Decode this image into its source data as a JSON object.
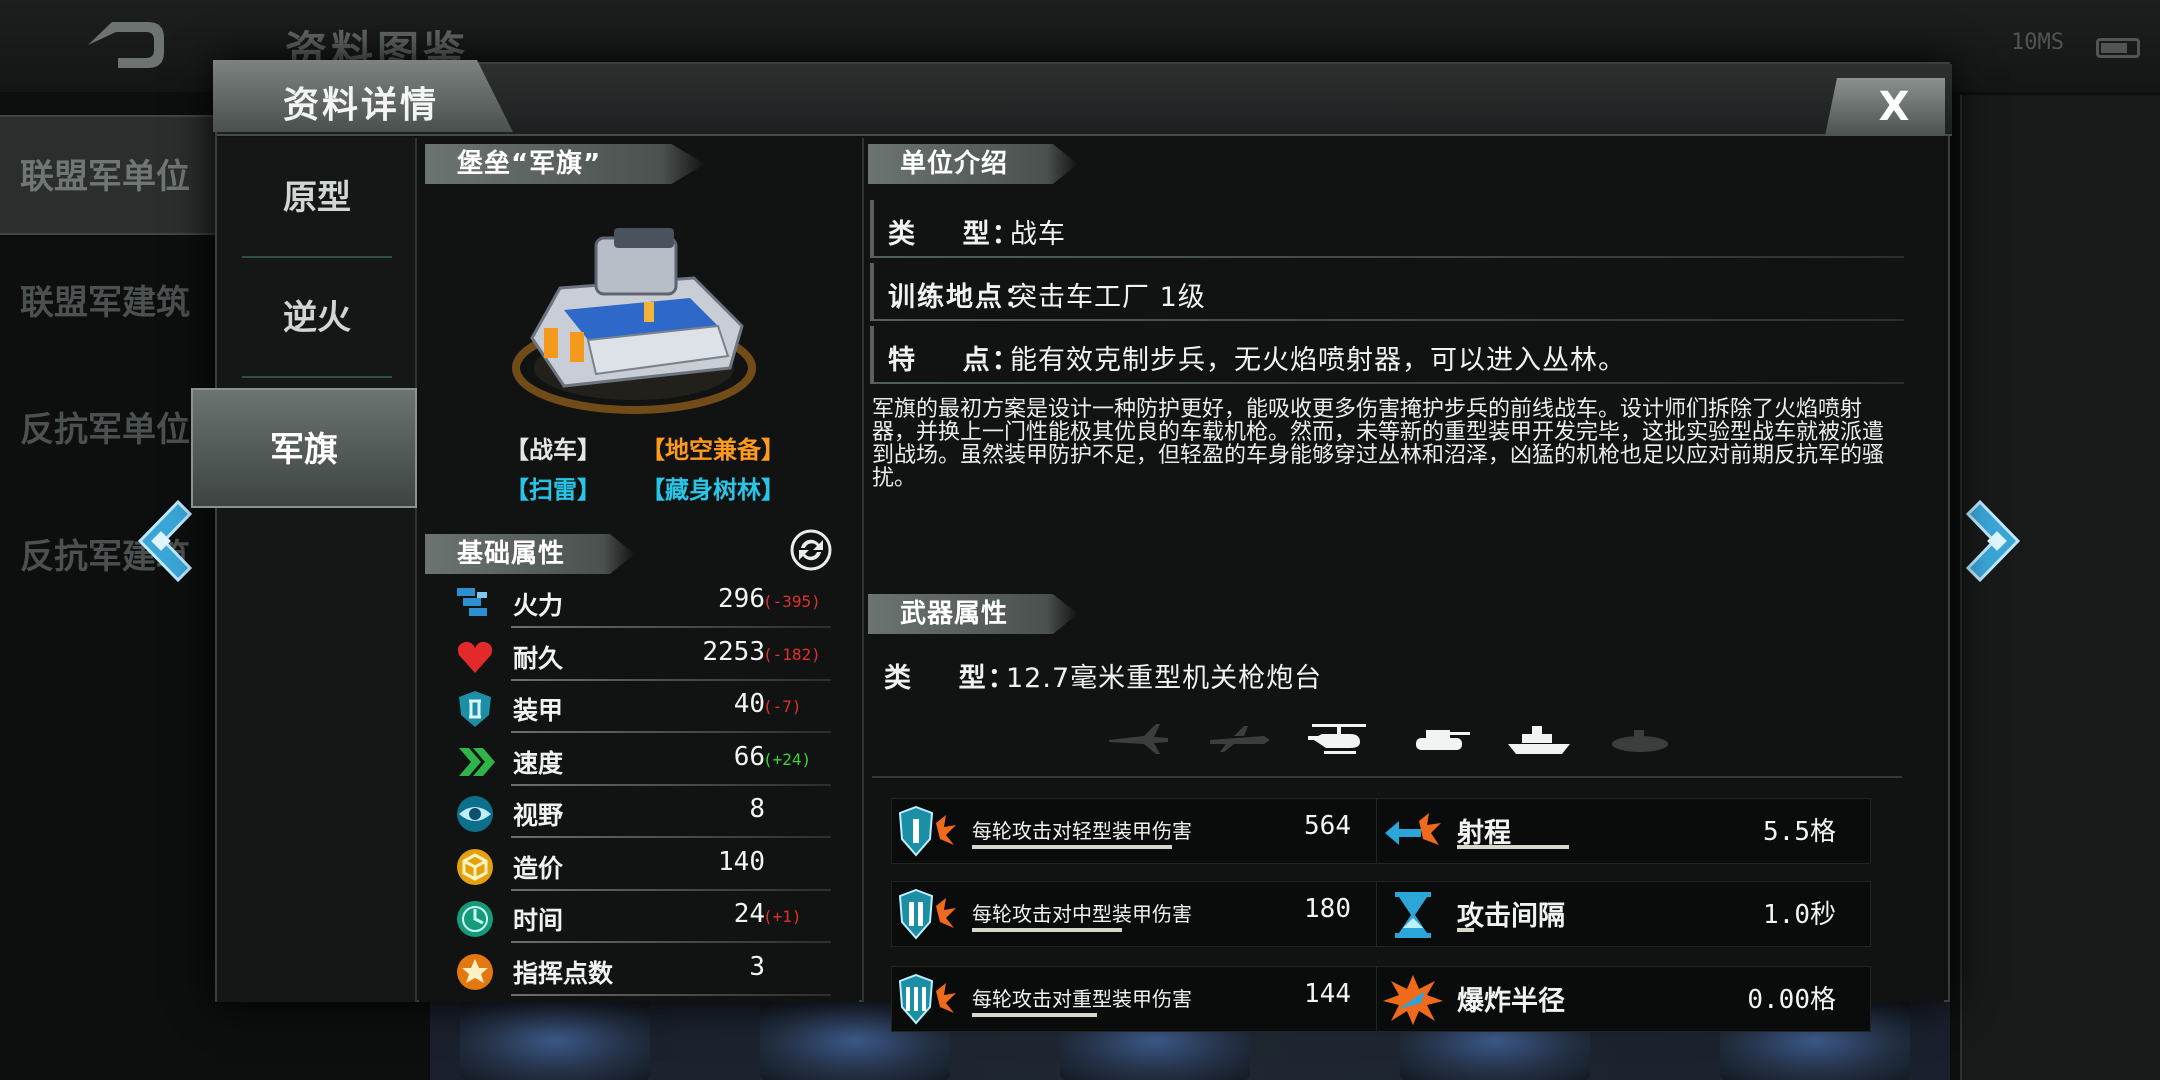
{
  "background": {
    "title": "资料图鉴",
    "status_text": "10MS",
    "sidebar": [
      "联盟军单位",
      "联盟军建筑",
      "反抗军单位",
      "反抗军建筑"
    ],
    "sidebar_active_index": 0
  },
  "modal": {
    "title": "资料详情",
    "close_label": "X",
    "unit_tabs": [
      {
        "label": "原型"
      },
      {
        "label": "逆火"
      },
      {
        "label": "军旗"
      }
    ],
    "unit": {
      "name": "堡垒“军旗”",
      "tags": [
        "【战车】",
        "【地空兼备】",
        "【扫雷】",
        "【藏身树林】"
      ],
      "tag_colors": [
        "#e6e6e6",
        "#ff9a1e",
        "#29c4e6",
        "#29c4e6"
      ]
    },
    "base_stats": {
      "title": "基础属性",
      "rows": [
        {
          "icon": "firepower-icon",
          "label": "火力",
          "value": "296",
          "delta": "(-395)",
          "delta_type": "neg"
        },
        {
          "icon": "heart-icon",
          "label": "耐久",
          "value": "2253",
          "delta": "(-182)",
          "delta_type": "neg"
        },
        {
          "icon": "shield-icon",
          "label": "装甲",
          "value": "40",
          "delta": "(-7)",
          "delta_type": "neg"
        },
        {
          "icon": "speed-chevron-icon",
          "label": "速度",
          "value": "66",
          "delta": "(+24)",
          "delta_type": "pos"
        },
        {
          "icon": "eye-icon",
          "label": "视野",
          "value": "8",
          "delta": "",
          "delta_type": ""
        },
        {
          "icon": "cube-cost-icon",
          "label": "造价",
          "value": "140",
          "delta": "",
          "delta_type": ""
        },
        {
          "icon": "clock-icon",
          "label": "时间",
          "value": "24",
          "delta": "(+1)",
          "delta_type": "neg"
        },
        {
          "icon": "star-command-icon",
          "label": "指挥点数",
          "value": "3",
          "delta": "",
          "delta_type": ""
        }
      ]
    },
    "intro": {
      "title": "单位介绍",
      "rows": [
        {
          "key": "类    型：",
          "value": "战车"
        },
        {
          "key": "训练地点：",
          "value": "突击车工厂 1级"
        },
        {
          "key": "特    点：",
          "value": "能有效克制步兵，无火焰喷射器，可以进入丛林。"
        }
      ],
      "description": "军旗的最初方案是设计一种防护更好，能吸收更多伤害掩护步兵的前线战车。设计师们拆除了火焰喷射器，并换上一门性能极其优良的车载机枪。然而，未等新的重型装甲开发完毕，这批实验型战车就被派遣到战场。虽然装甲防护不足，但轻盈的车身能够穿过丛林和沼泽，凶猛的机枪也足以应对前期反抗军的骚扰。"
    },
    "weapon": {
      "title": "武器属性",
      "type_key": "类    型：",
      "type_value": "12.7毫米重型机关枪炮台",
      "targets": [
        {
          "icon": "jet-icon",
          "active": false
        },
        {
          "icon": "plane-icon",
          "active": false
        },
        {
          "icon": "helicopter-icon",
          "active": true
        },
        {
          "icon": "tank-icon",
          "active": true
        },
        {
          "icon": "ship-icon",
          "active": true
        },
        {
          "icon": "submarine-icon",
          "active": false
        }
      ],
      "stats": [
        {
          "icon": "light-armor-icon",
          "label": "每轮攻击对轻型装甲伤害",
          "value": "564",
          "bar": 0.91
        },
        {
          "icon": "range-icon",
          "label": "射程",
          "value": "5.5格",
          "bar": 0.8,
          "big": true
        },
        {
          "icon": "medium-armor-icon",
          "label": "每轮攻击对中型装甲伤害",
          "value": "180",
          "bar": 0.68
        },
        {
          "icon": "hourglass-icon",
          "label": "攻击间隔",
          "value": "1.0秒",
          "bar": 0.12,
          "big": true
        },
        {
          "icon": "heavy-armor-icon",
          "label": "每轮攻击对重型装甲伤害",
          "value": "144",
          "bar": 0.57
        },
        {
          "icon": "explosion-icon",
          "label": "爆炸半径",
          "value": "0.00格",
          "bar": 0.0,
          "big": true
        }
      ]
    }
  }
}
